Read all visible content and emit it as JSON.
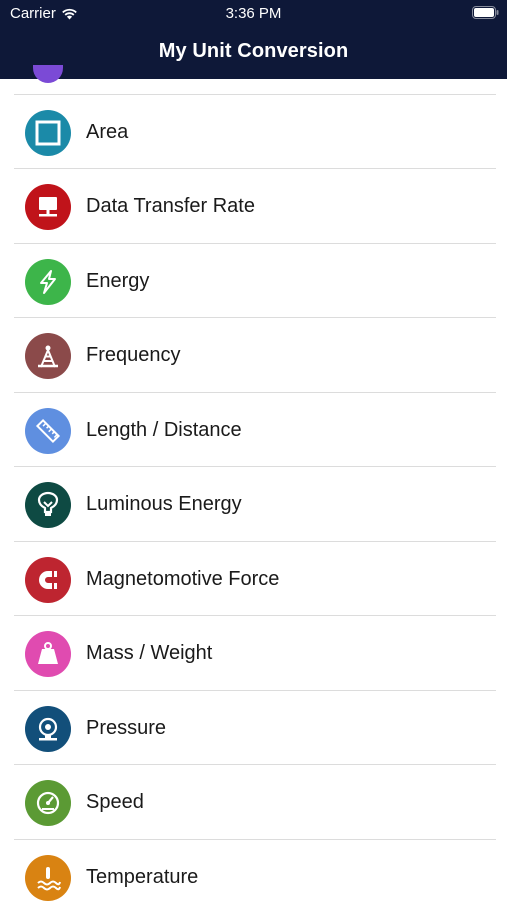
{
  "status_bar": {
    "carrier": "Carrier",
    "time": "3:36 PM"
  },
  "header": {
    "title": "My Unit Conversion"
  },
  "items": [
    {
      "label": "Area",
      "icon": "area-icon",
      "color": "#1b8aa8"
    },
    {
      "label": "Data Transfer Rate",
      "icon": "data-transfer-icon",
      "color": "#c0131a"
    },
    {
      "label": "Energy",
      "icon": "energy-icon",
      "color": "#3db54a"
    },
    {
      "label": "Frequency",
      "icon": "frequency-icon",
      "color": "#8b4a4a"
    },
    {
      "label": "Length / Distance",
      "icon": "ruler-icon",
      "color": "#5f8fe0"
    },
    {
      "label": "Luminous Energy",
      "icon": "bulb-icon",
      "color": "#0e4a43"
    },
    {
      "label": "Magnetomotive Force",
      "icon": "magnet-icon",
      "color": "#be2530"
    },
    {
      "label": "Mass / Weight",
      "icon": "weight-icon",
      "color": "#e04bb0"
    },
    {
      "label": "Pressure",
      "icon": "pressure-gauge-icon",
      "color": "#124f7a"
    },
    {
      "label": "Speed",
      "icon": "speedometer-icon",
      "color": "#5b9a34"
    },
    {
      "label": "Temperature",
      "icon": "temperature-icon",
      "color": "#d98312"
    }
  ]
}
